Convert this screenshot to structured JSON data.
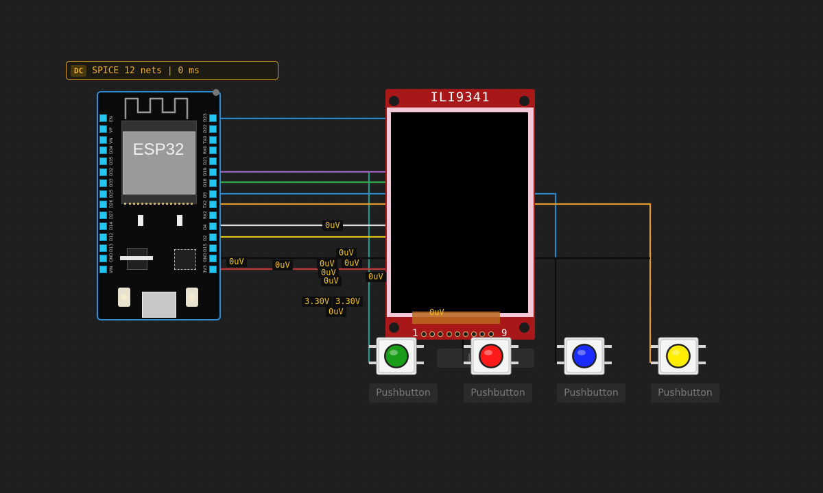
{
  "simulation": {
    "mode": "DC",
    "status": "SPICE 12 nets | 0 ms"
  },
  "esp32": {
    "label": "ESP32",
    "left_pins": [
      "EN",
      "VP",
      "VN",
      "D34",
      "D35",
      "D32",
      "D33",
      "D25",
      "D26",
      "D27",
      "D14",
      "D12",
      "D13",
      "GND",
      "VIN"
    ],
    "right_pins": [
      "D23",
      "D22",
      "TX0",
      "RX0",
      "D21",
      "D19",
      "D18",
      "D5",
      "TX2",
      "RX2",
      "D4",
      "D2",
      "D15",
      "GND",
      "3V3"
    ]
  },
  "display": {
    "title": "ILI9341",
    "pin_first": "1",
    "pin_last": "9",
    "ghost_label": "ILI9341",
    "colors": {
      "pcb": "#a81818",
      "frame": "#f5c8d8"
    }
  },
  "probes": [
    "0uV",
    "0uV",
    "0uV",
    "0uV",
    "0uV",
    "0uV",
    "0uV",
    "0uV",
    "0uV",
    "3.30V",
    "3.30V",
    "0uV",
    "0uV"
  ],
  "pushbuttons": [
    {
      "label": "Pushbutton",
      "color": "#1a9e1a"
    },
    {
      "label": "Pushbutton",
      "color": "#ff1a1a"
    },
    {
      "label": "Pushbutton",
      "color": "#1a2cff"
    },
    {
      "label": "Pushbutton",
      "color": "#ffee00"
    }
  ],
  "wire_colors": {
    "blue": "#2f86c8",
    "teal": "#1e9a8a",
    "red": "#c83a3a",
    "green": "#2aa84a",
    "purple": "#9a5ab8",
    "orange": "#e09a2a",
    "white": "#e0e0e0",
    "yellow": "#e0c020",
    "black": "#0a0a0a"
  }
}
